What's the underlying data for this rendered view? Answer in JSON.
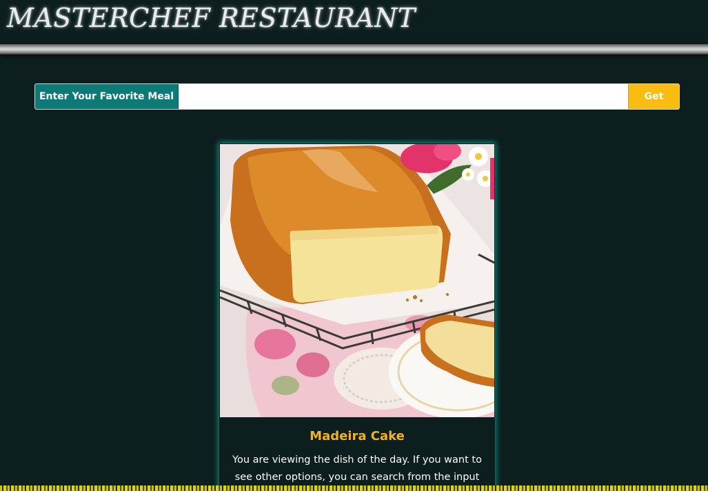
{
  "header": {
    "title": "MASTERCHEF RESTAURANT"
  },
  "search": {
    "label": "Enter Your Favorite Meal",
    "value": "",
    "placeholder": "",
    "button_label": "Get"
  },
  "dish": {
    "name": "Madeira Cake",
    "description": "You are viewing the dish of the day. If you want to see other options, you can search from the input",
    "image_subject": "madeira-cake-photo"
  },
  "colors": {
    "background": "#0c1e1e",
    "label_teal": "#0e7a78",
    "button_yellow": "#f9bd12",
    "dish_title": "#f4b223",
    "card_glow": "#14968c"
  }
}
